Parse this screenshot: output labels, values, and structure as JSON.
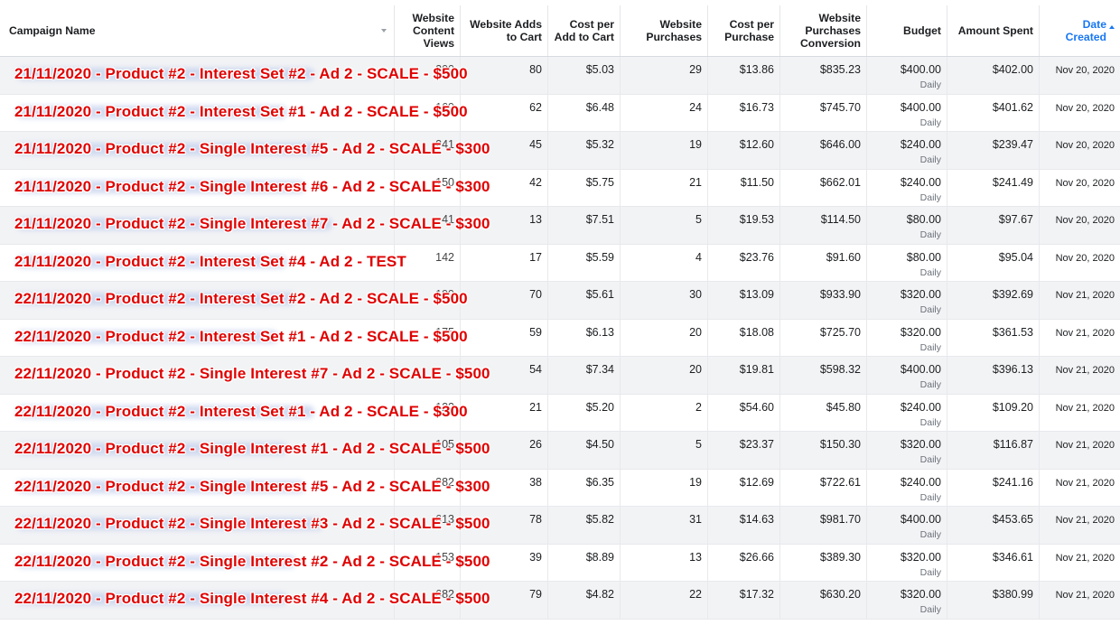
{
  "columns": {
    "campaign_name": "Campaign Name",
    "content_views": [
      "Website",
      "Content",
      "Views"
    ],
    "adds_to_cart": [
      "Website Adds",
      "to Cart"
    ],
    "cost_per_atc": [
      "Cost per",
      "Add to Cart"
    ],
    "purchases": [
      "Website",
      "Purchases"
    ],
    "cost_per_purchase": [
      "Cost per",
      "Purchase"
    ],
    "purchase_conversion": [
      "Website",
      "Purchases",
      "Conversion"
    ],
    "budget": "Budget",
    "amount_spent": "Amount Spent",
    "date_created": [
      "Date",
      "Created"
    ]
  },
  "budget_period": "Daily",
  "rows": [
    {
      "name": "21/11/2020 - Product #2 - Interest Set #2 - Ad 2 - SCALE - $500",
      "views": "200",
      "atc": "80",
      "cpatc": "$5.03",
      "purchases": "29",
      "cpp": "$13.86",
      "conv": "$835.23",
      "budget": "$400.00",
      "spent": "$402.00",
      "date": "Nov 20, 2020"
    },
    {
      "name": "21/11/2020 - Product #2 - Interest Set #1 - Ad 2 - SCALE - $500",
      "views": "169",
      "atc": "62",
      "cpatc": "$6.48",
      "purchases": "24",
      "cpp": "$16.73",
      "conv": "$745.70",
      "budget": "$400.00",
      "spent": "$401.62",
      "date": "Nov 20, 2020"
    },
    {
      "name": "21/11/2020 - Product #2 - Single Interest #5 - Ad 2 - SCALE - $300",
      "views": "241",
      "atc": "45",
      "cpatc": "$5.32",
      "purchases": "19",
      "cpp": "$12.60",
      "conv": "$646.00",
      "budget": "$240.00",
      "spent": "$239.47",
      "date": "Nov 20, 2020"
    },
    {
      "name": "21/11/2020 - Product #2 - Single Interest #6 - Ad 2 - SCALE - $300",
      "views": "150",
      "atc": "42",
      "cpatc": "$5.75",
      "purchases": "21",
      "cpp": "$11.50",
      "conv": "$662.01",
      "budget": "$240.00",
      "spent": "$241.49",
      "date": "Nov 20, 2020"
    },
    {
      "name": "21/11/2020 - Product #2 - Single Interest #7 - Ad 2 - SCALE - $300",
      "views": "41",
      "atc": "13",
      "cpatc": "$7.51",
      "purchases": "5",
      "cpp": "$19.53",
      "conv": "$114.50",
      "budget": "$80.00",
      "spent": "$97.67",
      "date": "Nov 20, 2020"
    },
    {
      "name": "21/11/2020 - Product #2 - Interest Set #4 - Ad 2 - TEST",
      "views": "142",
      "atc": "17",
      "cpatc": "$5.59",
      "purchases": "4",
      "cpp": "$23.76",
      "conv": "$91.60",
      "budget": "$80.00",
      "spent": "$95.04",
      "date": "Nov 20, 2020"
    },
    {
      "name": "22/11/2020 - Product #2 - Interest Set #2 - Ad 2 - SCALE - $500",
      "views": "199",
      "atc": "70",
      "cpatc": "$5.61",
      "purchases": "30",
      "cpp": "$13.09",
      "conv": "$933.90",
      "budget": "$320.00",
      "spent": "$392.69",
      "date": "Nov 21, 2020"
    },
    {
      "name": "22/11/2020 - Product #2 - Interest Set #1 - Ad 2 - SCALE - $500",
      "views": "175",
      "atc": "59",
      "cpatc": "$6.13",
      "purchases": "20",
      "cpp": "$18.08",
      "conv": "$725.70",
      "budget": "$320.00",
      "spent": "$361.53",
      "date": "Nov 21, 2020"
    },
    {
      "name": "22/11/2020 - Product #2 - Single Interest #7 - Ad 2 - SCALE - $500",
      "views": "",
      "atc": "54",
      "cpatc": "$7.34",
      "purchases": "20",
      "cpp": "$19.81",
      "conv": "$598.32",
      "budget": "$400.00",
      "spent": "$396.13",
      "date": "Nov 21, 2020"
    },
    {
      "name": "22/11/2020 - Product #2 - Interest Set #1 - Ad 2 - SCALE - $300",
      "views": "122",
      "atc": "21",
      "cpatc": "$5.20",
      "purchases": "2",
      "cpp": "$54.60",
      "conv": "$45.80",
      "budget": "$240.00",
      "spent": "$109.20",
      "date": "Nov 21, 2020"
    },
    {
      "name": "22/11/2020 - Product #2 - Single Interest #1 - Ad 2 - SCALE - $500",
      "views": "105",
      "atc": "26",
      "cpatc": "$4.50",
      "purchases": "5",
      "cpp": "$23.37",
      "conv": "$150.30",
      "budget": "$320.00",
      "spent": "$116.87",
      "date": "Nov 21, 2020"
    },
    {
      "name": "22/11/2020 - Product #2 - Single Interest #5 - Ad 2 - SCALE - $300",
      "views": "282",
      "atc": "38",
      "cpatc": "$6.35",
      "purchases": "19",
      "cpp": "$12.69",
      "conv": "$722.61",
      "budget": "$240.00",
      "spent": "$241.16",
      "date": "Nov 21, 2020"
    },
    {
      "name": "22/11/2020 - Product #2 - Single Interest #3 - Ad 2 - SCALE - $500",
      "views": "613",
      "atc": "78",
      "cpatc": "$5.82",
      "purchases": "31",
      "cpp": "$14.63",
      "conv": "$981.70",
      "budget": "$400.00",
      "spent": "$453.65",
      "date": "Nov 21, 2020"
    },
    {
      "name": "22/11/2020 - Product #2 - Single Interest #2 - Ad 2 - SCALE - $500",
      "views": "153",
      "atc": "39",
      "cpatc": "$8.89",
      "purchases": "13",
      "cpp": "$26.66",
      "conv": "$389.30",
      "budget": "$320.00",
      "spent": "$346.61",
      "date": "Nov 21, 2020"
    },
    {
      "name": "22/11/2020 - Product #2 - Single Interest #4 - Ad 2 - SCALE - $500",
      "views": "682",
      "atc": "79",
      "cpatc": "$4.82",
      "purchases": "22",
      "cpp": "$17.32",
      "conv": "$630.20",
      "budget": "$320.00",
      "spent": "$380.99",
      "date": "Nov 21, 2020"
    }
  ]
}
